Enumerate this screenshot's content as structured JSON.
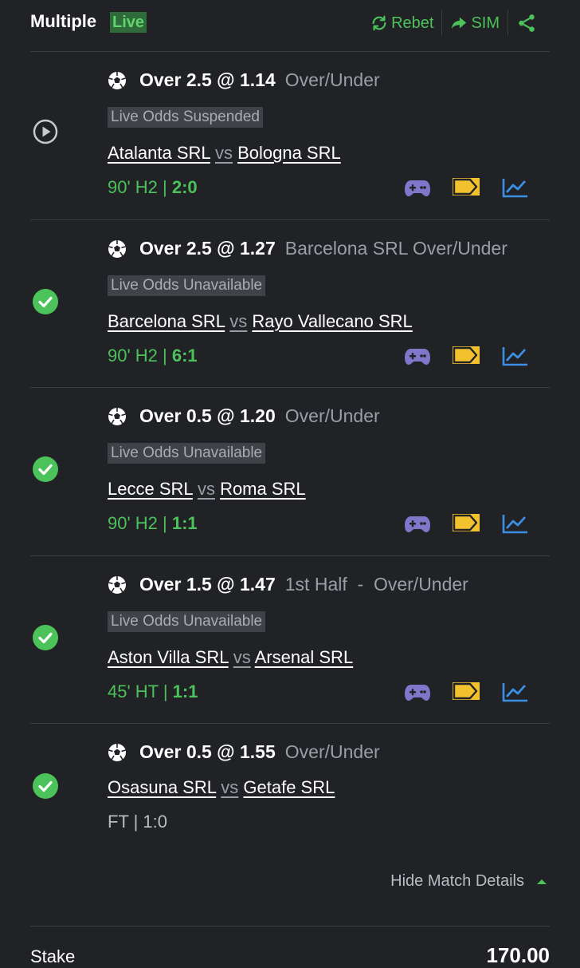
{
  "header": {
    "title": "Multiple",
    "live_badge": "Live",
    "rebet_label": "Rebet",
    "sim_label": "SIM"
  },
  "colors": {
    "accent_green": "#4cc25a",
    "live_bg": "#2f6b3a",
    "gamepad": "#7f77c9",
    "ticket": "#f2c12e",
    "stats": "#3d8fe6",
    "background": "#202226"
  },
  "bets": [
    {
      "status": "live",
      "status_icon": "play-circle-icon",
      "selection": "Over 2.5 @ 1.14",
      "market": "Over/Under",
      "odds_status": "Live Odds Suspended",
      "home": "Atalanta SRL",
      "vs": "vs",
      "away": "Bologna SRL",
      "clock": "90' H2 |",
      "score": "2:0"
    },
    {
      "status": "won",
      "status_icon": "check-circle-icon",
      "selection": "Over 2.5 @ 1.27",
      "market": "Barcelona SRL Over/Under",
      "odds_status": "Live Odds Unavailable",
      "home": "Barcelona SRL",
      "vs": "vs",
      "away": "Rayo Vallecano SRL",
      "clock": "90' H2 |",
      "score": "6:1"
    },
    {
      "status": "won",
      "status_icon": "check-circle-icon",
      "selection": "Over 0.5 @ 1.20",
      "market": "Over/Under",
      "odds_status": "Live Odds Unavailable",
      "home": "Lecce SRL",
      "vs": "vs",
      "away": "Roma SRL",
      "clock": "90' H2 |",
      "score": "1:1"
    },
    {
      "status": "won",
      "status_icon": "check-circle-icon",
      "selection": "Over 1.5 @ 1.47",
      "market": "1st Half  -  Over/Under",
      "odds_status": "Live Odds Unavailable",
      "home": "Aston Villa SRL",
      "vs": "vs",
      "away": "Arsenal SRL",
      "clock": "45' HT |",
      "score": "1:1"
    },
    {
      "status": "won",
      "status_icon": "check-circle-icon",
      "selection": "Over 0.5 @ 1.55",
      "market": "Over/Under",
      "home": "Osasuna SRL",
      "vs": "vs",
      "away": "Getafe SRL",
      "result": "FT | 1:0"
    }
  ],
  "footer": {
    "hide_details_label": "Hide Match Details",
    "stake_label": "Stake",
    "stake_value": "170.00"
  }
}
